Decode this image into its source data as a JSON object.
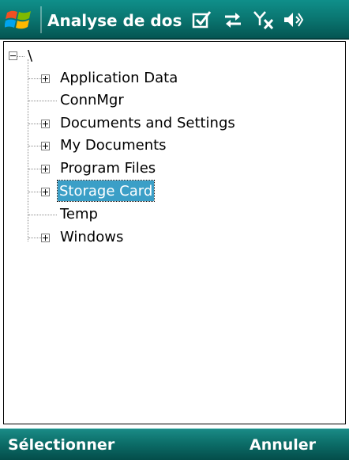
{
  "titlebar": {
    "title": "Analyse de dossie",
    "icons": [
      "windows-start-icon",
      "task-check-icon",
      "sync-arrows-icon",
      "no-signal-icon",
      "speaker-volume-icon"
    ]
  },
  "tree": {
    "root": {
      "label": "\\",
      "expander": "minus"
    },
    "items": [
      {
        "label": "Application Data",
        "expander": "plus",
        "selected": false
      },
      {
        "label": "ConnMgr",
        "expander": "none",
        "selected": false
      },
      {
        "label": "Documents and Settings",
        "expander": "plus",
        "selected": false
      },
      {
        "label": "My Documents",
        "expander": "plus",
        "selected": false
      },
      {
        "label": "Program Files",
        "expander": "plus",
        "selected": false
      },
      {
        "label": "Storage Card",
        "expander": "plus",
        "selected": true
      },
      {
        "label": "Temp",
        "expander": "none",
        "selected": false
      },
      {
        "label": "Windows",
        "expander": "plus",
        "selected": false
      }
    ]
  },
  "softkeys": {
    "left_label": "Sélectionner",
    "right_label": "Annuler"
  },
  "colors": {
    "titlebar": "#0a7570",
    "selection": "#3b9fc7",
    "softbar": "#0c6e69"
  }
}
